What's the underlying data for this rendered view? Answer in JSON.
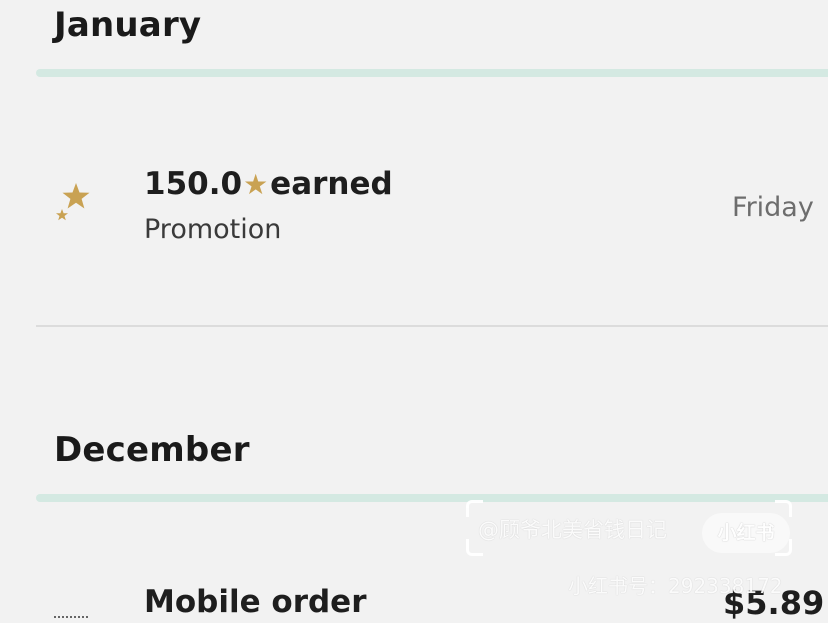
{
  "months": {
    "january": {
      "label": "January"
    },
    "december": {
      "label": "December"
    }
  },
  "transactions": [
    {
      "amount": "150.0",
      "star_glyph": "★",
      "suffix": "earned",
      "subtitle": "Promotion",
      "date": "Friday",
      "icon": "stars-icon"
    },
    {
      "title": "Mobile order",
      "amount": "$5.89",
      "icon": "receipt-icon"
    }
  ],
  "watermark": {
    "handle": "@顾爷北美省钱日记",
    "logo": "小红书",
    "account_id": "小红书号：292338172"
  },
  "colors": {
    "background": "#f2f2f2",
    "month_bar": "#d4e9e2",
    "star_gold": "#c9a253",
    "divider": "#dcdcdc"
  }
}
